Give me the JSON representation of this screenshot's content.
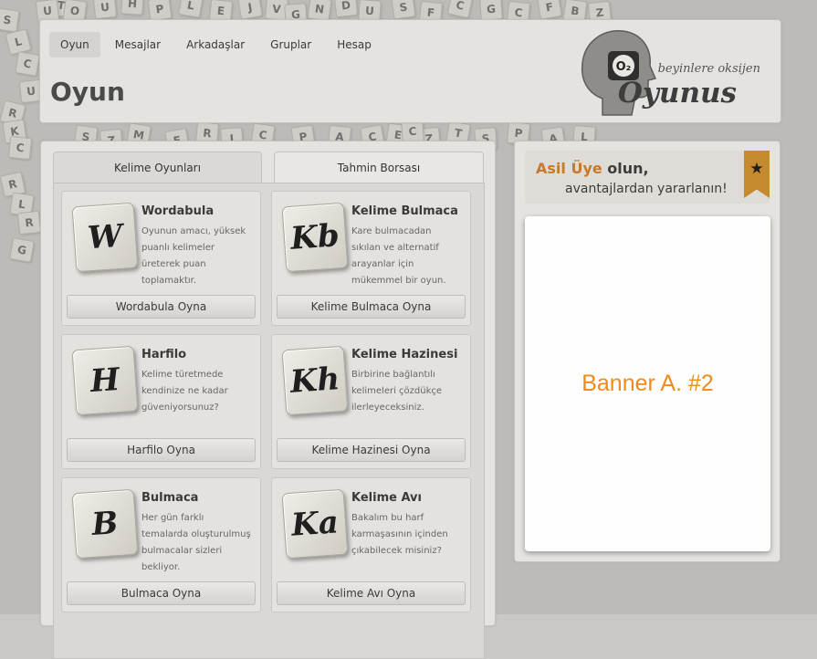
{
  "nav": {
    "items": [
      "Oyun",
      "Mesajlar",
      "Arkadaşlar",
      "Gruplar",
      "Hesap"
    ],
    "active": "Oyun"
  },
  "page": {
    "title": "Oyun"
  },
  "logo": {
    "o2": "O₂",
    "tagline": "beyinlere oksijen",
    "word": "Oyunus"
  },
  "tabs": [
    {
      "label": "Kelime Oyunları",
      "active": true
    },
    {
      "label": "Tahmin Borsası",
      "active": false
    }
  ],
  "games": [
    {
      "tile": "W",
      "title": "Wordabula",
      "desc": "Oyunun amacı, yüksek puanlı kelimeler üreterek puan toplamaktır.",
      "button": "Wordabula Oyna"
    },
    {
      "tile": "Kb",
      "title": "Kelime Bulmaca",
      "desc": "Kare bulmacadan sıkılan ve alternatif arayanlar için mükemmel bir oyun.",
      "button": "Kelime Bulmaca Oyna"
    },
    {
      "tile": "H",
      "title": "Harfilo",
      "desc": "Kelime türetmede kendinize ne kadar güveniyorsunuz?",
      "button": "Harfilo Oyna"
    },
    {
      "tile": "Kh",
      "title": "Kelime Hazinesi",
      "desc": "Birbirine bağlantılı kelimeleri çözdükçe ilerleyeceksiniz.",
      "button": "Kelime Hazinesi Oyna"
    },
    {
      "tile": "B",
      "title": "Bulmaca",
      "desc": "Her gün farklı temalarda oluşturulmuş bulmacalar sizleri bekliyor.",
      "button": "Bulmaca Oyna"
    },
    {
      "tile": "Ka",
      "title": "Kelime Avı",
      "desc": "Bakalım bu harf karmaşasının içinden çıkabilecek misiniz?",
      "button": "Kelime Avı Oyna"
    }
  ],
  "promo": {
    "accent": "Asil Üye",
    "line1_rest": " olun,",
    "line2": "avantajlardan yararlanın!",
    "ribbon_icon": "star-icon"
  },
  "banner": {
    "label": "Banner A. #2"
  },
  "background_tiles": [
    "T",
    "U",
    "H",
    "P",
    "L",
    "E",
    "J",
    "V",
    "G",
    "N",
    "D",
    "U",
    "S",
    "F",
    "C",
    "G",
    "C",
    "F",
    "B",
    "Z",
    "S",
    "L",
    "C",
    "U",
    "R",
    "K",
    "C",
    "R",
    "L",
    "R",
    "G",
    "S",
    "Z",
    "M",
    "F",
    "R",
    "I",
    "C",
    "P",
    "A",
    "C",
    "E",
    "Z",
    "T",
    "S",
    "P",
    "A",
    "L",
    "U",
    "O",
    "C"
  ],
  "colors": {
    "accent": "#c87a2a",
    "banner_text": "#f08a1a",
    "ribbon": "#c68a2e"
  }
}
